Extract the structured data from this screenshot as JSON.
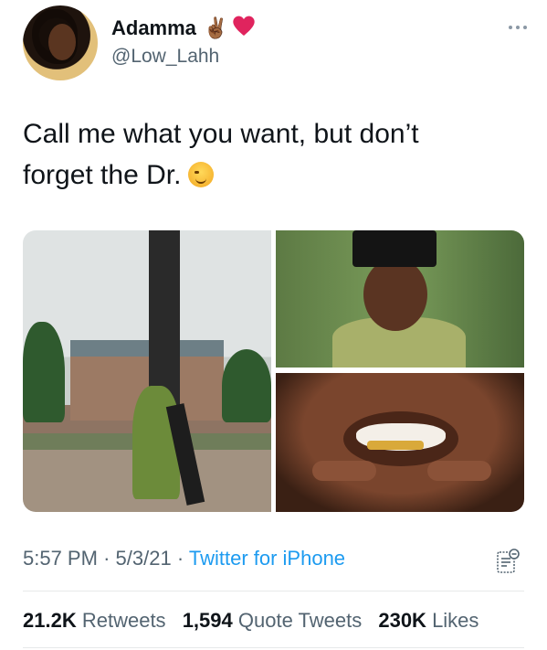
{
  "author": {
    "name": "Adamma",
    "handle": "@Low_Lahh",
    "emojis": [
      "✌🏾",
      "❤️"
    ]
  },
  "tweet": {
    "text_line1": "Call me what you want, but don’t",
    "text_line2": "forget the Dr."
  },
  "meta": {
    "time": "5:57 PM",
    "date": "5/3/21",
    "separator": "·",
    "source": "Twitter for iPhone"
  },
  "stats": {
    "retweets_count": "21.2K",
    "retweets_label": "Retweets",
    "quotes_count": "1,594",
    "quotes_label": "Quote Tweets",
    "likes_count": "230K",
    "likes_label": "Likes"
  },
  "colors": {
    "text": "#0f1419",
    "secondary": "#536471",
    "link": "#1d9bf0",
    "divider": "#e7e9ea",
    "heart": "#e0245e"
  }
}
